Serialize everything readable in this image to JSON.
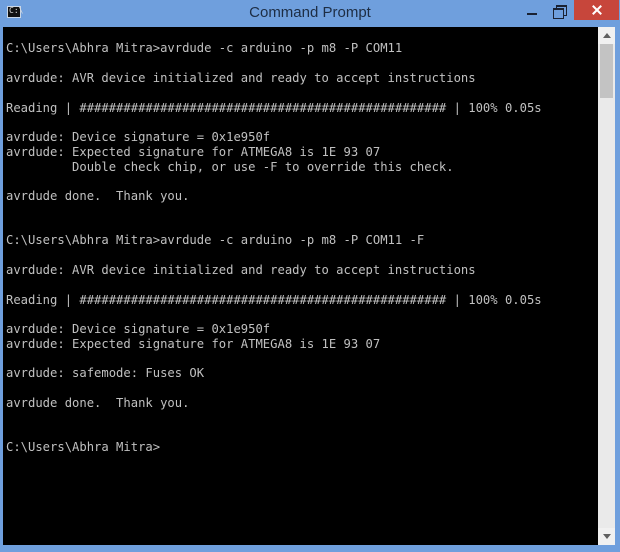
{
  "window": {
    "title": "Command Prompt",
    "icon_text": "C:\\",
    "accent_color": "#6f9fdd",
    "close_color": "#c7463b"
  },
  "console": {
    "background": "#000000",
    "foreground": "#c0c0c0",
    "lines": [
      "C:\\Users\\Abhra Mitra>avrdude -c arduino -p m8 -P COM11",
      "",
      "avrdude: AVR device initialized and ready to accept instructions",
      "",
      "Reading | ################################################## | 100% 0.05s",
      "",
      "avrdude: Device signature = 0x1e950f",
      "avrdude: Expected signature for ATMEGA8 is 1E 93 07",
      "         Double check chip, or use -F to override this check.",
      "",
      "avrdude done.  Thank you.",
      "",
      "",
      "C:\\Users\\Abhra Mitra>avrdude -c arduino -p m8 -P COM11 -F",
      "",
      "avrdude: AVR device initialized and ready to accept instructions",
      "",
      "Reading | ################################################## | 100% 0.05s",
      "",
      "avrdude: Device signature = 0x1e950f",
      "avrdude: Expected signature for ATMEGA8 is 1E 93 07",
      "",
      "avrdude: safemode: Fuses OK",
      "",
      "avrdude done.  Thank you.",
      "",
      "",
      "C:\\Users\\Abhra Mitra>"
    ]
  },
  "scrollbar": {
    "position": 0.0
  }
}
